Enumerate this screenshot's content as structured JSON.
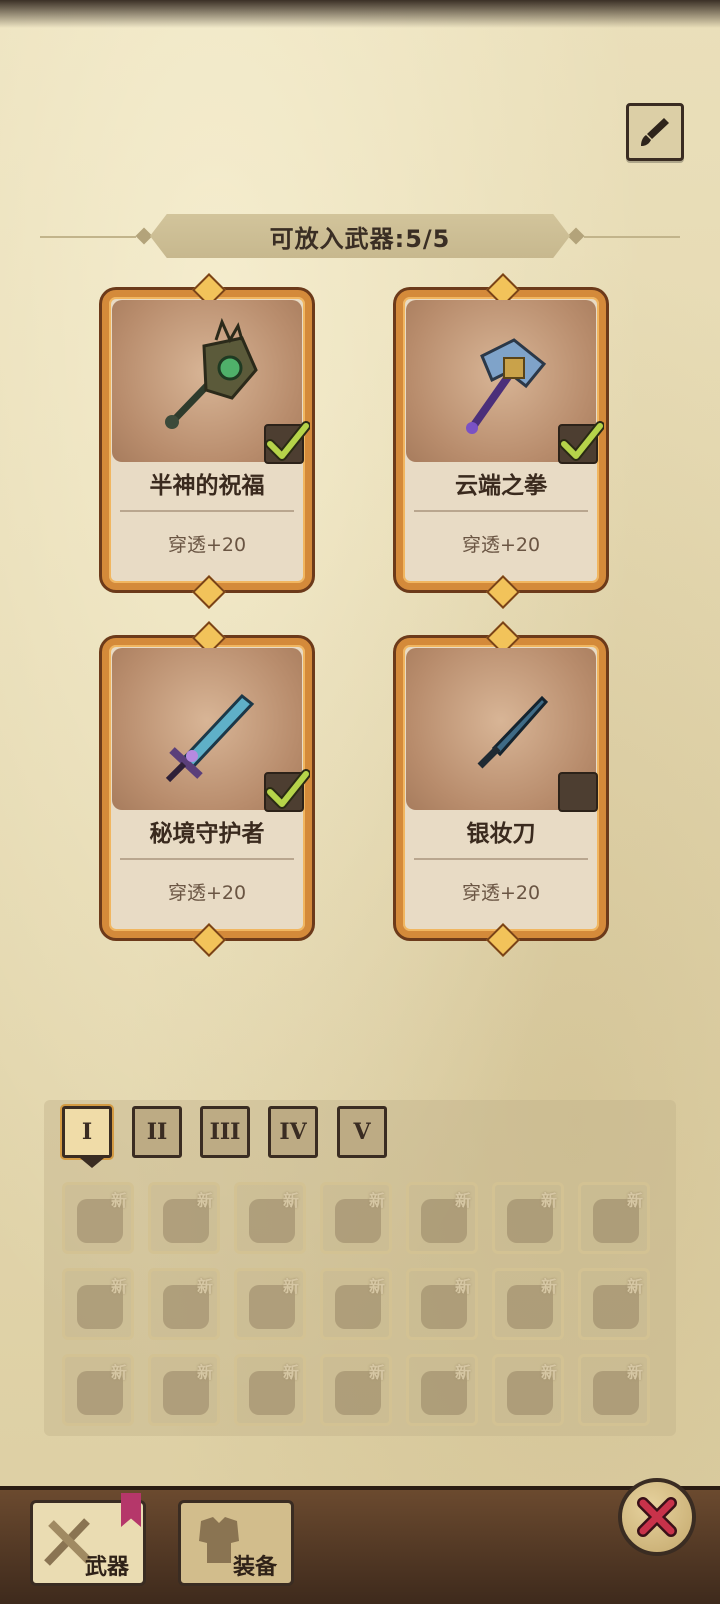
{
  "header": {
    "capacity_label": "可放入武器:5/5"
  },
  "weapons": [
    {
      "name": "半神的祝福",
      "stat": "穿透+20",
      "selected": true,
      "icon": "staff-icon"
    },
    {
      "name": "云端之拳",
      "stat": "穿透+20",
      "selected": true,
      "icon": "hammer-icon"
    },
    {
      "name": "秘境守护者",
      "stat": "穿透+20",
      "selected": true,
      "icon": "sword-icon"
    },
    {
      "name": "银妆刀",
      "stat": "穿透+20",
      "selected": false,
      "icon": "blade-icon"
    }
  ],
  "tier_tabs": [
    {
      "label": "I",
      "active": true
    },
    {
      "label": "II",
      "active": false
    },
    {
      "label": "III",
      "active": false
    },
    {
      "label": "IV",
      "active": false
    },
    {
      "label": "V",
      "active": false
    }
  ],
  "inventory": {
    "new_badge": "新",
    "items": [
      "helmet-icon",
      "helmet-icon",
      "armor-icon",
      "armor-icon",
      "armor-icon",
      "armor-icon",
      "armor-icon",
      "chest-icon",
      "chest-icon",
      "greaves-icon",
      "boots-icon",
      "boots-icon",
      "boots-icon",
      "bracer-icon",
      "bracer-icon",
      "bracer-icon",
      "gauntlet-icon",
      "necklace-icon",
      "necklace-icon",
      "ring-icon",
      "amulet-icon"
    ]
  },
  "bottom_nav": {
    "weapons_label": "武器",
    "equipment_label": "装备"
  },
  "colors": {
    "frame_orange": "#d48a3a",
    "check_green": "#b6d44a",
    "close_red": "#c8324a"
  }
}
